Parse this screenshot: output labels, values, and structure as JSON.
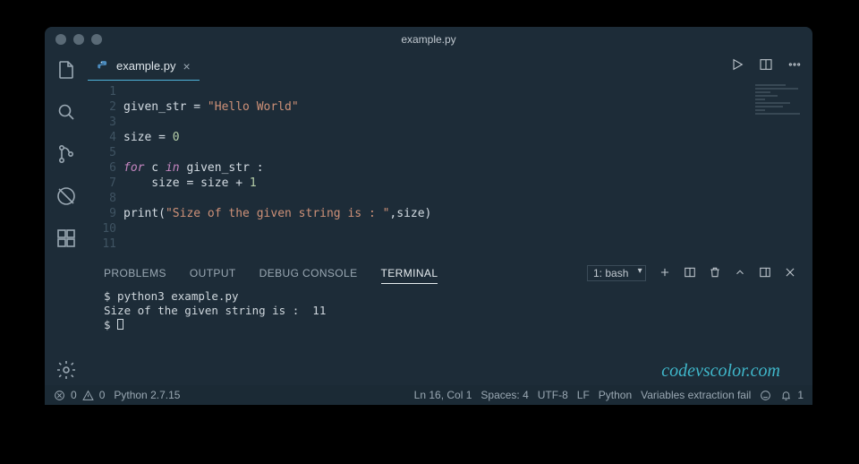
{
  "window": {
    "title": "example.py"
  },
  "tab": {
    "filename": "example.py"
  },
  "code": {
    "lines": [
      {
        "n": 1,
        "html": ""
      },
      {
        "n": 2,
        "html": "given_str = <span class='str'>\"Hello World\"</span>"
      },
      {
        "n": 3,
        "html": ""
      },
      {
        "n": 4,
        "html": "size = <span class='num'>0</span>"
      },
      {
        "n": 5,
        "html": ""
      },
      {
        "n": 6,
        "html": "<span class='kw'>for</span> c <span class='kw'>in</span> given_str :"
      },
      {
        "n": 7,
        "html": "    size = size + <span class='num'>1</span>"
      },
      {
        "n": 8,
        "html": ""
      },
      {
        "n": 9,
        "html": "print(<span class='str'>\"Size of the given string is : \"</span>,size)"
      },
      {
        "n": 10,
        "html": ""
      },
      {
        "n": 11,
        "html": ""
      }
    ]
  },
  "panel": {
    "tabs": {
      "problems": "PROBLEMS",
      "output": "OUTPUT",
      "debug": "DEBUG CONSOLE",
      "terminal": "TERMINAL"
    },
    "shell": "1: bash"
  },
  "terminal": {
    "line1": "$ python3 example.py",
    "line2": "Size of the given string is :  11",
    "prompt": "$ "
  },
  "watermark": "codevscolor.com",
  "status": {
    "errors": "0",
    "warnings": "0",
    "python": "Python 2.7.15",
    "pos": "Ln 16, Col 1",
    "spaces": "Spaces: 4",
    "encoding": "UTF-8",
    "eol": "LF",
    "lang": "Python",
    "ext": "Variables extraction fail",
    "bell": "1"
  }
}
